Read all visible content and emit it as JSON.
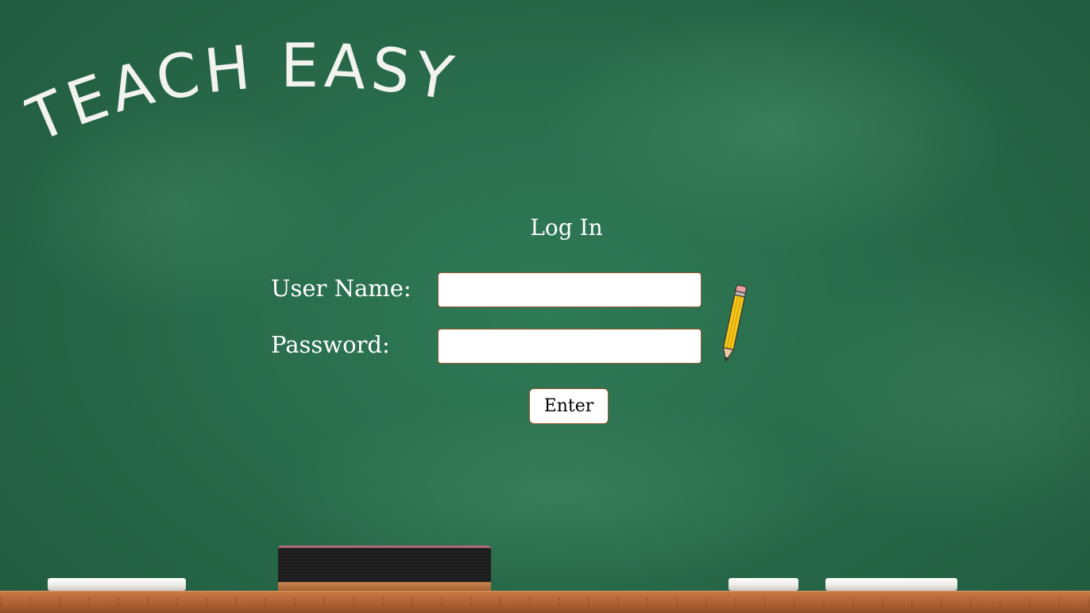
{
  "app": {
    "title": "TEACH EASY"
  },
  "login": {
    "heading": "Log In",
    "username_label": "User Name:",
    "username_value": "",
    "password_label": "Password:",
    "password_value": "",
    "enter_label": "Enter"
  },
  "icons": {
    "pencil": "pencil-icon",
    "eraser": "chalkboard-eraser",
    "chalk": "chalk-piece"
  },
  "colors": {
    "board": "#2a6b4c",
    "chalk_text": "#f2f2ee",
    "field_border": "#9b5a2a",
    "ledge": "#b8693a"
  }
}
